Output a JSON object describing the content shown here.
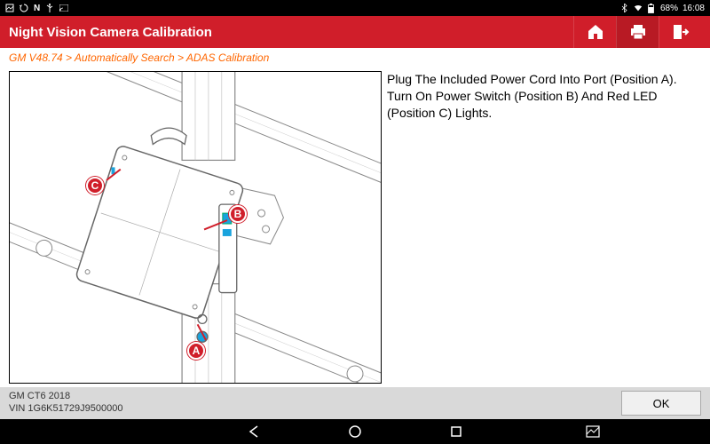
{
  "status": {
    "time": "16:08",
    "battery": "68%"
  },
  "header": {
    "title": "Night Vision Camera Calibration"
  },
  "breadcrumb": {
    "text": "GM V48.74 > Automatically Search > ADAS Calibration"
  },
  "instructions": {
    "text": "Plug The Included Power Cord Into Port (Position A). Turn On Power Switch (Position B) And Red LED (Position C) Lights."
  },
  "callouts": {
    "a": "A",
    "b": "B",
    "c": "C"
  },
  "footer": {
    "vehicle": "GM CT6 2018",
    "vin": "VIN 1G6K51729J9500000",
    "ok_label": "OK"
  }
}
